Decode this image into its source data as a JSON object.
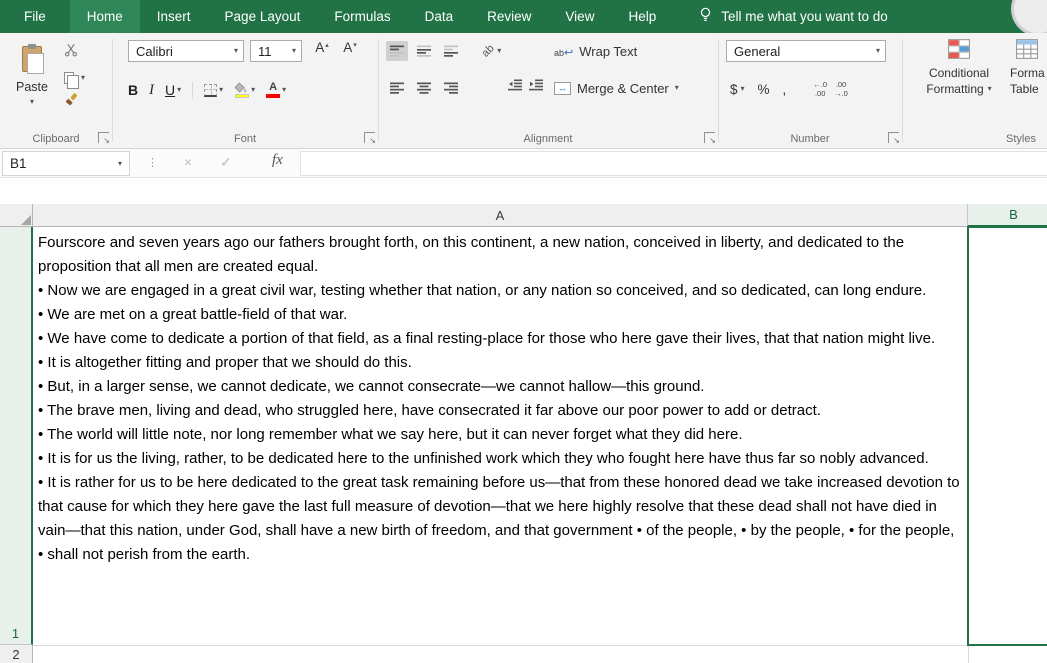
{
  "tabs": {
    "items": [
      {
        "label": "File"
      },
      {
        "label": "Home"
      },
      {
        "label": "Insert"
      },
      {
        "label": "Page Layout"
      },
      {
        "label": "Formulas"
      },
      {
        "label": "Data"
      },
      {
        "label": "Review"
      },
      {
        "label": "View"
      },
      {
        "label": "Help"
      }
    ],
    "active_tab": "Home",
    "tell_me": "Tell me what you want to do"
  },
  "ribbon": {
    "clipboard": {
      "label": "Clipboard",
      "paste": "Paste"
    },
    "font": {
      "label": "Font",
      "family": "Calibri",
      "size": "11",
      "bold": "B",
      "italic": "I",
      "underline": "U"
    },
    "alignment": {
      "label": "Alignment",
      "wrap_text": "Wrap Text",
      "merge_center": "Merge & Center",
      "orientation_ab": "ab"
    },
    "number": {
      "label": "Number",
      "format": "General",
      "currency": "$",
      "percent": "%",
      "comma": ",",
      "inc_decimal_top": "←.0",
      "inc_decimal_bottom": ".00",
      "dec_decimal_top": ".00",
      "dec_decimal_bottom": "→.0"
    },
    "styles": {
      "label": "Styles",
      "conditional_line1": "Conditional",
      "conditional_line2": "Formatting",
      "format_table_line1": "Forma",
      "format_table_line2": "Table"
    }
  },
  "formula_bar": {
    "name_box": "B1",
    "fx": "fx",
    "value": ""
  },
  "sheet": {
    "columns": [
      "A",
      "B"
    ],
    "rows": [
      "1",
      "2"
    ],
    "selected_cell": "B1",
    "a1_lines": [
      "Fourscore and seven years ago our fathers brought forth, on this continent, a new nation, conceived in liberty, and dedicated to the proposition that all men are created equal.",
      "• Now we are engaged in a great civil war, testing whether that nation, or any nation so conceived, and so dedicated, can long endure.",
      "• We are met on a great battle-field of that war.",
      "• We have come to dedicate a portion of that field, as a final resting-place for those who here gave their lives, that that nation might live.",
      "• It is altogether fitting and proper that we should do this.",
      "• But, in a larger sense, we cannot dedicate, we cannot consecrate—we cannot hallow—this ground.",
      "• The brave men, living and dead, who struggled here, have consecrated it far above our poor power to add or detract.",
      "• The world will little note, nor long remember what we say here, but it can never forget what they did here.",
      "• It is for us the living, rather, to be dedicated here to the unfinished work which they who fought here have thus far so nobly advanced.",
      "• It is rather for us to be here dedicated to the great task remaining before us—that from these honored dead we take increased devotion to that cause for which they here gave the last full measure of devotion—that we here highly resolve that these dead shall not have died in vain—that this nation, under God, shall have a new birth of freedom, and that government • of the people, • by the people, • for the people,",
      "• shall not perish from the earth."
    ]
  },
  "icons": {
    "caret": "▾",
    "launcher": "↘",
    "more_dots": "⋮",
    "cancel": "×",
    "confirm": "✓",
    "size_up": "▴",
    "size_down": "▾",
    "letter_a": "A",
    "wrap_ab": "ab",
    "return_arrow": "↩",
    "merge_arrows": "↔"
  },
  "colors": {
    "excel_green": "#217346",
    "active_tab_green": "#2f8757",
    "ribbon_bg": "#f3f3f3",
    "fill_color_swatch": "#ffff00",
    "font_color_swatch": "#ff0000",
    "selection_green": "#217346"
  }
}
